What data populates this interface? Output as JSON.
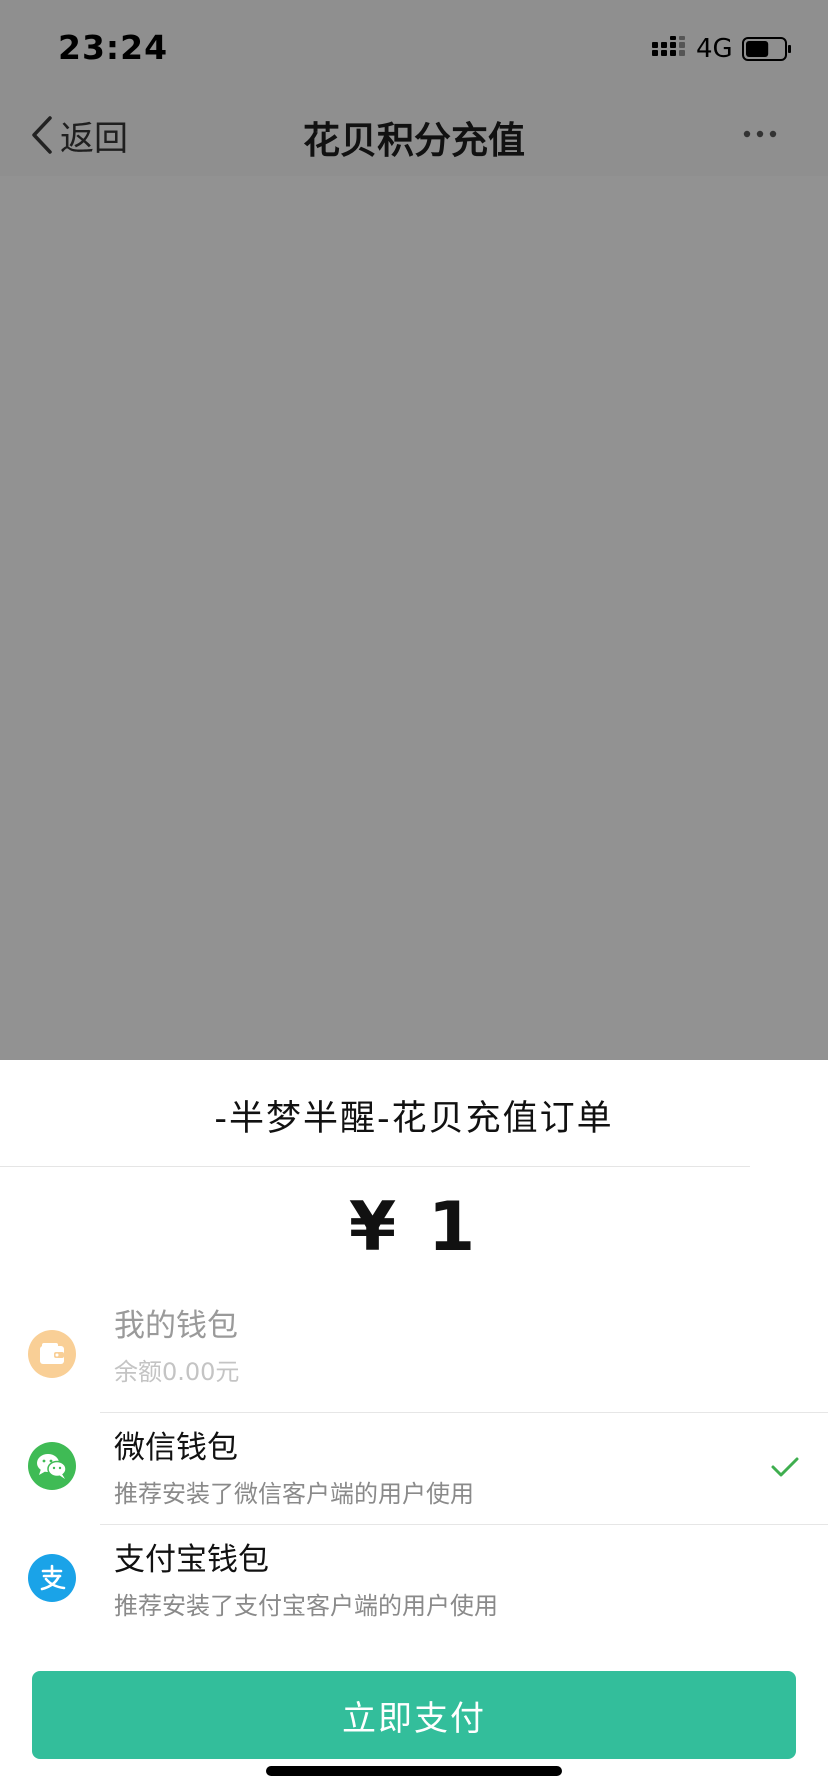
{
  "status_bar": {
    "time": "23:24",
    "network": "4G",
    "icons": [
      "cellular-signal-icon",
      "battery-icon"
    ],
    "battery_level": 0.6
  },
  "nav": {
    "back_label": "返回",
    "title": "花贝积分充值",
    "more_icon": "more-dots-icon"
  },
  "sheet": {
    "order_title": "-半梦半醒-花贝充值订单",
    "amount": "¥ 1",
    "options": [
      {
        "name": "我的钱包",
        "desc": "余额0.00元",
        "icon": "wallet-icon",
        "icon_color": "#f9cf96",
        "enabled": false,
        "selected": false
      },
      {
        "name": "微信钱包",
        "desc": "推荐安装了微信客户端的用户使用",
        "icon": "wechat-icon",
        "icon_color": "#3fbb55",
        "enabled": true,
        "selected": true
      },
      {
        "name": "支付宝钱包",
        "desc": "推荐安装了支付宝客户端的用户使用",
        "icon": "alipay-icon",
        "icon_color": "#1aa3e8",
        "enabled": true,
        "selected": false
      }
    ],
    "pay_button": "立即支付"
  },
  "colors": {
    "overlay": "#8f8f8f",
    "accent": "#33be9b",
    "check": "#3fae4f"
  }
}
